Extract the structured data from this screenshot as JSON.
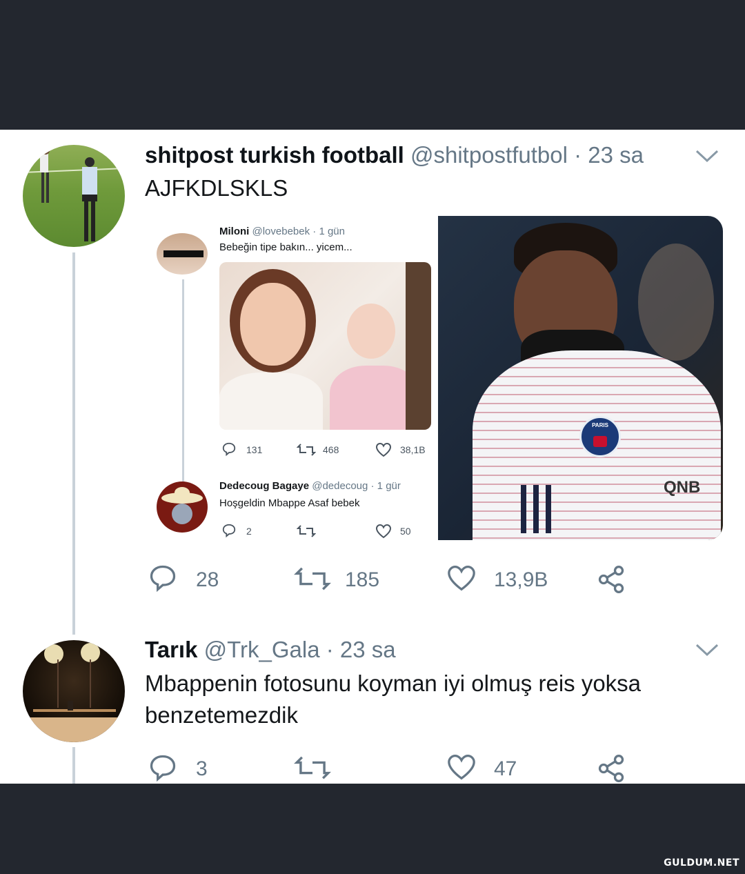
{
  "tweet1": {
    "display_name": "shitpost turkish football",
    "handle": "@shitpostfutbol",
    "time": "· 23 sa",
    "text": "AJFKDLSKLS",
    "replies": "28",
    "retweets": "185",
    "likes": "13,9B"
  },
  "embedded": {
    "tweet_a": {
      "display_name": "Miloni",
      "handle": "@lovebebek",
      "time": "· 1 gün",
      "text": "Bebeğin tipe bakın... yicem...",
      "replies": "131",
      "retweets": "468",
      "likes": "38,1B"
    },
    "tweet_b": {
      "display_name": "Dedecoug Bagaye",
      "handle": "@dedecoug",
      "time": "· 1 gür",
      "text": "Hoşgeldin Mbappe Asaf bebek",
      "replies": "2",
      "retweets": "",
      "likes": "50"
    }
  },
  "photo": {
    "sponsor": "QNB",
    "crest": "PARIS"
  },
  "tweet2": {
    "display_name": "Tarık",
    "handle": "@Trk_Gala",
    "time": "· 23 sa",
    "text_line1": "Mbappenin fotosunu koyman iyi olmuş reis yoksa",
    "text_line2": "benzetemezdik",
    "replies": "3",
    "retweets": "",
    "likes": "47"
  },
  "watermark": "GULDUM.NET",
  "colors": {
    "text": "#14171a",
    "muted": "#657786",
    "bar": "#23272f",
    "thread": "#c9d1d9"
  }
}
